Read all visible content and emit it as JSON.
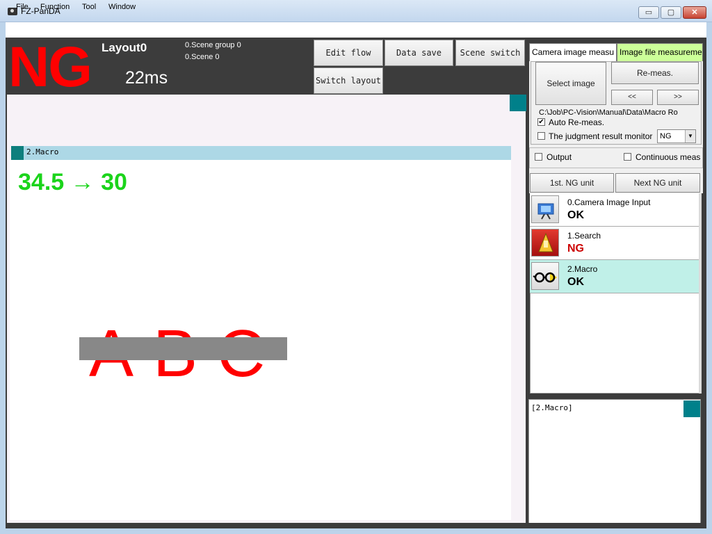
{
  "window": {
    "title": "FZ-PanDA",
    "min_glyph": "▭",
    "max_glyph": "▢",
    "close_glyph": "✕"
  },
  "menu": [
    "File",
    "Function",
    "Tool",
    "Window"
  ],
  "status": {
    "judgment": "NG",
    "judgment_color": "#ff0000",
    "layout": "Layout0",
    "time": "22ms",
    "scene_group": "0.Scene group 0",
    "scene": "0.Scene 0"
  },
  "toolbar": {
    "edit_flow": "Edit flow",
    "data_save": "Data save",
    "scene_switch": "Scene switch",
    "switch_layout": "Switch layout"
  },
  "image_window": {
    "header": "2.Macro",
    "measurement": "34.5 → 30",
    "measurement_color": "#1bd41b",
    "letters": [
      "A",
      "B",
      "C"
    ]
  },
  "measure_panel": {
    "tabs": [
      "Camera image measu",
      "Image file measureme"
    ],
    "active_tab": "Image file measureme",
    "select_image": "Select image",
    "remeas": "Re-meas.",
    "prev": "<<",
    "next": ">>",
    "file_path": "C:\\Job\\PC-Vision\\Manual\\Data\\Macro  Ro",
    "auto_remeas": {
      "label": "Auto Re-meas.",
      "checked": true
    },
    "judgment_monitor": {
      "label": "The judgment result monitor",
      "checked": false,
      "value": "NG"
    },
    "output": {
      "label": "Output",
      "checked": false
    },
    "continuous": {
      "label": "Continuous meas",
      "checked": false
    }
  },
  "flow_nav": {
    "first_ng": "1st. NG unit",
    "next_ng": "Next NG unit"
  },
  "units": [
    {
      "name": "0.Camera Image Input",
      "result": "OK",
      "result_color": "#000000",
      "icon": "camera-input-icon",
      "selected": false
    },
    {
      "name": "1.Search",
      "result": "NG",
      "result_color": "#cc0000",
      "icon": "search-unit-icon",
      "selected": false
    },
    {
      "name": "2.Macro",
      "result": "OK",
      "result_color": "#000000",
      "icon": "macro-glasses-icon",
      "selected": true
    }
  ],
  "detail": {
    "label": "[2.Macro]"
  }
}
